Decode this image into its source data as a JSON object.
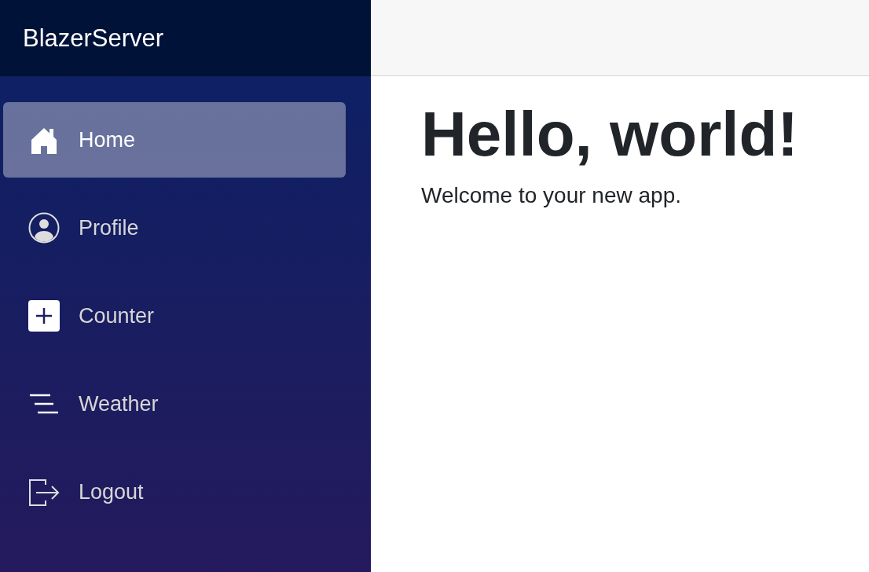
{
  "sidebar": {
    "brand": "BlazerServer",
    "items": [
      {
        "label": "Home",
        "kind": "home",
        "selected": true
      },
      {
        "label": "Profile",
        "kind": "profile",
        "selected": false
      },
      {
        "label": "Counter",
        "kind": "counter",
        "selected": false
      },
      {
        "label": "Weather",
        "kind": "weather",
        "selected": false
      },
      {
        "label": "Logout",
        "kind": "logout",
        "selected": false
      }
    ]
  },
  "main": {
    "heading": "Hello, world!",
    "text": "Welcome to your new app."
  }
}
